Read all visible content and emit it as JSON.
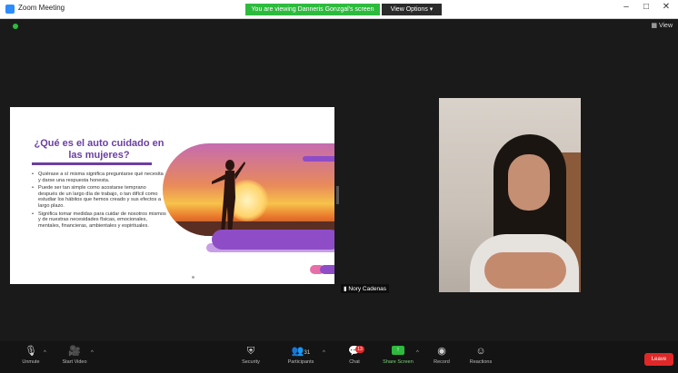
{
  "window": {
    "title": "Zoom Meeting",
    "share_banner": "You are viewing Danneris Gonzgal's screen",
    "view_options": "View Options ▾",
    "controls": {
      "minimize": "–",
      "maximize": "□",
      "close": "✕"
    }
  },
  "stage": {
    "view_label": "View",
    "status_color": "#2dbb3d"
  },
  "slide": {
    "title": "¿Qué es el auto cuidado en las mujeres?",
    "bullets": [
      "Quiérase a sí misma significa preguntarse qué necesita y darse una respuesta honesta.",
      "Puede ser tan simple como acostarse temprano después de un largo día de trabajo, o tan difícil como estudiar los hábitos que hemos creado y sus efectos a largo plazo.",
      "Significa tomar medidas para cuidar de nosotros mismos y de nuestras necesidades físicas, emocionales, mentales, financieras, ambientales y espirituales."
    ],
    "accent_color": "#6b3fa0"
  },
  "participant": {
    "name": "Nory Cadenas"
  },
  "toolbar": {
    "items": [
      {
        "label": "Unmute",
        "icon": "microphone-muted-icon"
      },
      {
        "label": "Start Video",
        "icon": "camera-off-icon"
      },
      {
        "label": "Security",
        "icon": "shield-icon"
      },
      {
        "label": "Participants",
        "icon": "participants-icon",
        "count": "31"
      },
      {
        "label": "Chat",
        "icon": "chat-icon",
        "badge": "13"
      },
      {
        "label": "Share Screen",
        "icon": "share-screen-icon"
      },
      {
        "label": "Record",
        "icon": "record-icon"
      },
      {
        "label": "Reactions",
        "icon": "reactions-icon"
      }
    ],
    "end_label": "Leave",
    "end_color": "#e02828"
  }
}
